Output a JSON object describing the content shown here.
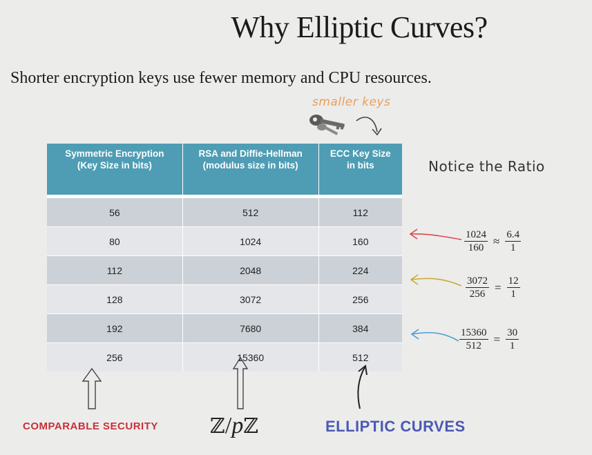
{
  "slide": {
    "title": "Why Elliptic Curves?",
    "subtitle": "Shorter encryption keys use fewer memory and CPU resources.",
    "annotation_keys": "smaller keys",
    "annotation_ratio": "Notice the Ratio"
  },
  "table": {
    "headers": [
      [
        "Symmetric Encryption",
        "(Key Size in bits)"
      ],
      [
        "RSA and Diffie-Hellman",
        "(modulus size in bits)"
      ],
      [
        "ECC Key Size",
        "in bits"
      ]
    ],
    "rows": [
      [
        "56",
        "512",
        "112"
      ],
      [
        "80",
        "1024",
        "160"
      ],
      [
        "112",
        "2048",
        "224"
      ],
      [
        "128",
        "3072",
        "256"
      ],
      [
        "192",
        "7680",
        "384"
      ],
      [
        "256",
        "15360",
        "512"
      ]
    ]
  },
  "ratios": [
    {
      "num": "1024",
      "den": "160",
      "op": "≈",
      "rnum": "6.4",
      "rden": "1",
      "arrow_color": "#d94a4a"
    },
    {
      "num": "3072",
      "den": "256",
      "op": "=",
      "rnum": "12",
      "rden": "1",
      "arrow_color": "#c9a830"
    },
    {
      "num": "15360",
      "den": "512",
      "op": "=",
      "rnum": "30",
      "rden": "1",
      "arrow_color": "#4a9fd0"
    }
  ],
  "labels": {
    "comparable": "COMPARABLE SECURITY",
    "field_z": "ℤ",
    "field_slash": "/",
    "field_p": "p",
    "elliptic": "ELLIPTIC CURVES"
  },
  "colors": {
    "header_bg": "#4e9db4",
    "row_dark": "#cbd1d7",
    "row_light": "#e4e6e9",
    "comparable_red": "#c8303a",
    "elliptic_blue": "#4a59b4"
  },
  "icons": [
    "keys-icon",
    "curved-arrow-icon",
    "up-arrow-icon"
  ]
}
